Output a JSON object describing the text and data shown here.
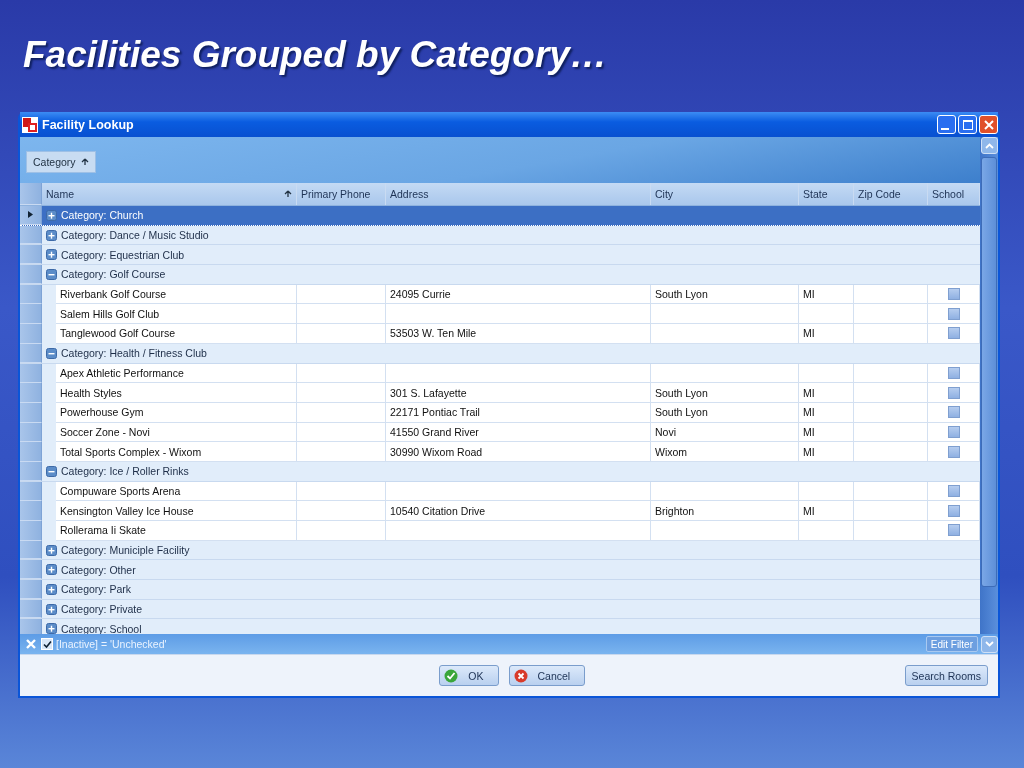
{
  "slide_title": "Facilities Grouped by Category…",
  "window": {
    "title": "Facility Lookup"
  },
  "group_panel": {
    "chip": "Category",
    "sorted": true
  },
  "table": {
    "columns": [
      {
        "label": "Name",
        "sorted": true
      },
      {
        "label": "Primary Phone",
        "sorted": false
      },
      {
        "label": "Address",
        "sorted": false
      },
      {
        "label": "City",
        "sorted": false
      },
      {
        "label": "State",
        "sorted": false
      },
      {
        "label": "Zip Code",
        "sorted": false
      },
      {
        "label": "School",
        "sorted": false
      }
    ],
    "groups": [
      {
        "label": "Category: Church",
        "expanded": false,
        "selected": true
      },
      {
        "label": "Category: Dance / Music Studio",
        "expanded": false,
        "selected": false
      },
      {
        "label": "Category: Equestrian Club",
        "expanded": false,
        "selected": false
      },
      {
        "label": "Category: Golf Course",
        "expanded": true,
        "selected": false,
        "rows": [
          {
            "name": "Riverbank Golf Course",
            "address": "24095 Currie",
            "city": "South Lyon",
            "state": "MI",
            "school": false
          },
          {
            "name": "Salem Hills Golf Club",
            "school": false
          },
          {
            "name": "Tanglewood Golf Course",
            "address": "53503 W. Ten Mile",
            "state": "MI",
            "school": false
          }
        ]
      },
      {
        "label": "Category: Health / Fitness Club",
        "expanded": true,
        "selected": false,
        "rows": [
          {
            "name": "Apex Athletic Performance",
            "school": false
          },
          {
            "name": "Health Styles",
            "address": "301 S. Lafayette",
            "city": "South Lyon",
            "state": "MI",
            "school": false
          },
          {
            "name": "Powerhouse Gym",
            "address": "22171 Pontiac Trail",
            "city": "South Lyon",
            "state": "MI",
            "school": false
          },
          {
            "name": "Soccer Zone - Novi",
            "address": "41550 Grand River",
            "city": "Novi",
            "state": "MI",
            "school": false
          },
          {
            "name": "Total Sports Complex - Wixom",
            "address": "30990 Wixom Road",
            "city": "Wixom",
            "state": "MI",
            "school": false
          }
        ]
      },
      {
        "label": "Category: Ice / Roller Rinks",
        "expanded": true,
        "selected": false,
        "rows": [
          {
            "name": "Compuware Sports Arena",
            "school": false
          },
          {
            "name": "Kensington Valley Ice House",
            "address": "10540 Citation Drive",
            "city": "Brighton",
            "state": "MI",
            "school": false
          },
          {
            "name": "Rollerama Ii Skate",
            "school": false
          }
        ]
      },
      {
        "label": "Category: Municiple Facility",
        "expanded": false,
        "selected": false
      },
      {
        "label": "Category: Other",
        "expanded": false,
        "selected": false
      },
      {
        "label": "Category: Park",
        "expanded": false,
        "selected": false
      },
      {
        "label": "Category: Private",
        "expanded": false,
        "selected": false
      },
      {
        "label": "Category: School",
        "expanded": false,
        "selected": false
      }
    ]
  },
  "filter": {
    "checked": true,
    "text": "[Inactive] = 'Unchecked'",
    "edit_button": "Edit Filter"
  },
  "buttons": [
    {
      "label": "OK",
      "kind": "ok"
    },
    {
      "label": "Cancel",
      "kind": "cancel"
    },
    {
      "label": "Search Rooms",
      "kind": "plain"
    }
  ]
}
